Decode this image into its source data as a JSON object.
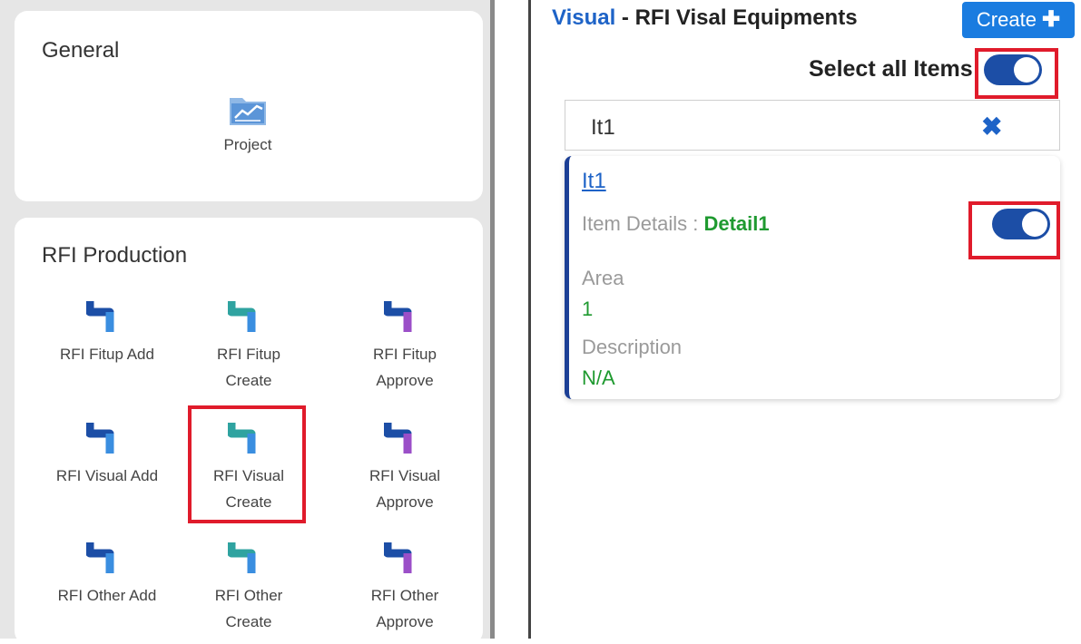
{
  "left": {
    "general": {
      "title": "General",
      "tiles": [
        {
          "label": "Project",
          "icon": "chart-folder-icon"
        }
      ]
    },
    "rfi_production": {
      "title": "RFI Production",
      "tiles": [
        {
          "label": "RFI Fitup Add",
          "variant": "blue"
        },
        {
          "label": "RFI Fitup Create",
          "variant": "teal"
        },
        {
          "label": "RFI Fitup Approve",
          "variant": "purple"
        },
        {
          "label": "RFI Visual Add",
          "variant": "blue"
        },
        {
          "label": "RFI Visual Create",
          "variant": "teal",
          "highlighted": true
        },
        {
          "label": "RFI Visual Approve",
          "variant": "purple"
        },
        {
          "label": "RFI Other Add",
          "variant": "blue"
        },
        {
          "label": "RFI Other Create",
          "variant": "teal"
        },
        {
          "label": "RFI Other Approve",
          "variant": "purple"
        }
      ]
    }
  },
  "right": {
    "title_brand": "Visual",
    "title_rest": " - RFI Visal Equipments",
    "create_label": "Create",
    "create_icon": "plus-icon",
    "select_all_label": "Select all Items",
    "select_all_on": true,
    "search_value": "It1",
    "clear_icon": "close-icon",
    "item": {
      "id": "It1",
      "details_label": "Item Details : ",
      "details_value": "Detail1",
      "toggle_on": true,
      "area_label": "Area",
      "area_value": "1",
      "description_label": "Description",
      "description_value": "N/A"
    }
  },
  "colors": {
    "accent": "#1e63c7",
    "toggle": "#1c4ea6",
    "value_green": "#1f9a30",
    "highlight_red": "#e01b2b",
    "create_button": "#1a7ce0"
  }
}
